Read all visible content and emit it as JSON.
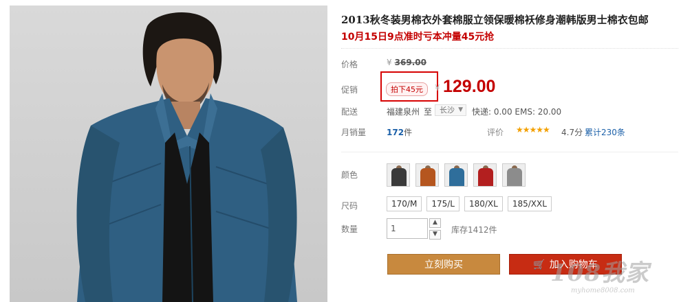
{
  "product": {
    "title": "2013秋冬装男棉衣外套棉服立领保暖棉袄修身潮韩版男士棉衣包邮",
    "promo_headline": "10月15日9点准时亏本冲量45元抢"
  },
  "price": {
    "label": "价格",
    "currency": "¥",
    "original": "369.00"
  },
  "promotion": {
    "label": "促销",
    "badge": "拍下45元",
    "currency": "¥",
    "sale_price": "129.00"
  },
  "shipping": {
    "label": "配送",
    "from": "福建泉州",
    "to_label": "至",
    "destination": "长沙",
    "fees": "快递: 0.00 EMS: 20.00"
  },
  "sales": {
    "label": "月销量",
    "count": "172",
    "unit": "件",
    "rating_label": "评价",
    "stars": "★★★★★",
    "score": "4.7分",
    "reviews": "累计230条"
  },
  "color": {
    "label": "颜色",
    "swatches": [
      "#3a3a3a",
      "#b5561f",
      "#2f6e9b",
      "#b31f1f",
      "#8c8c8c"
    ]
  },
  "size": {
    "label": "尺码",
    "options": [
      "170/M",
      "175/L",
      "180/XL",
      "185/XXL"
    ]
  },
  "quantity": {
    "label": "数量",
    "value": "1",
    "stock": "库存1412件"
  },
  "actions": {
    "buy_now": "立刻购买",
    "add_to_cart": "加入购物车"
  },
  "watermark": {
    "text": "108我家",
    "url": "myhome8008.com"
  },
  "colors": {
    "accent_red": "#c40000",
    "buy_button": "#c8893e",
    "cart_button": "#c72c13",
    "link_blue": "#1a5fa8"
  }
}
